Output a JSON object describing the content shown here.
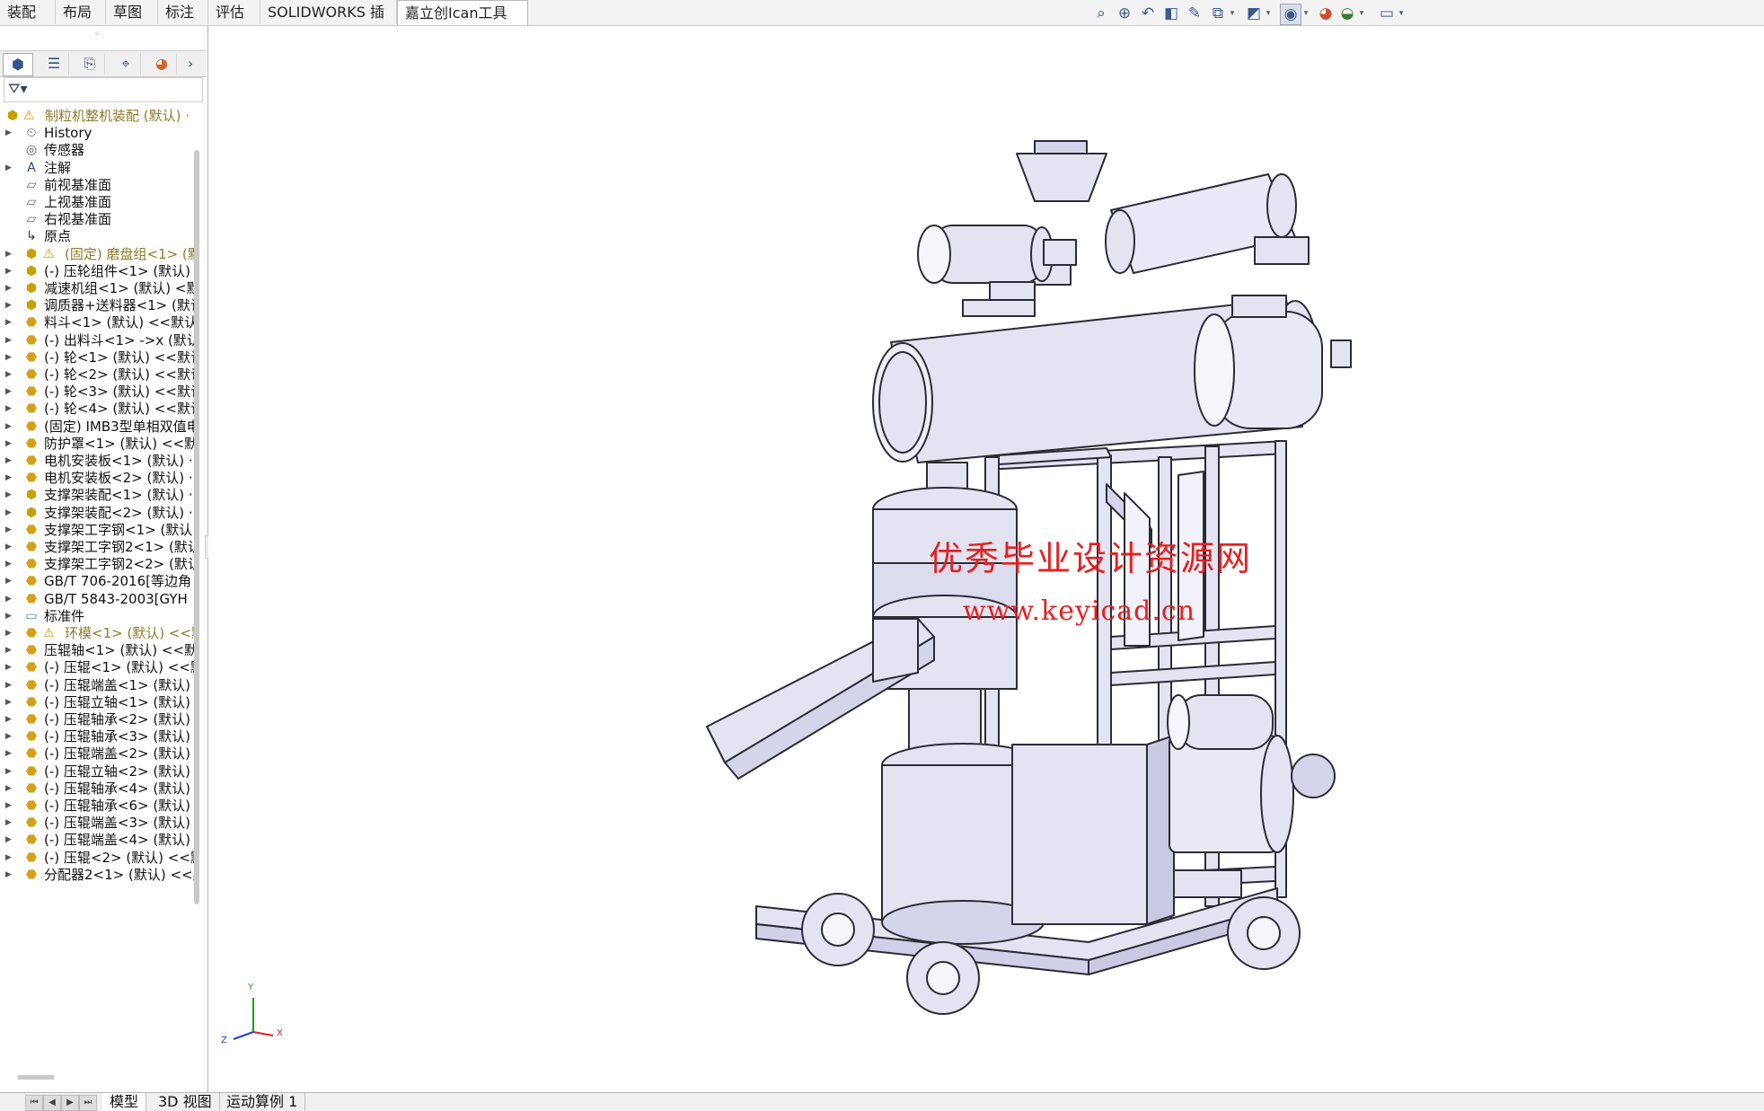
{
  "top_tabs": [
    "装配体",
    "布局",
    "草图",
    "标注",
    "评估",
    "SOLIDWORKS 插件",
    "嘉立创Ican工具箱"
  ],
  "hud_icons": [
    "zoom-to-fit-icon",
    "zoom-area-icon",
    "previous-view-icon",
    "section-view-icon",
    "dynamic-annotation-icon",
    "view-orientation-icon",
    "display-style-icon",
    "hide-show-icon",
    "edit-appearance-icon",
    "apply-scene-icon",
    "view-settings-icon"
  ],
  "panel_tabs": [
    "featuremanager-icon",
    "propertymanager-icon",
    "configurationmanager-icon",
    "dimxpert-icon",
    "appearance-icon"
  ],
  "tree": [
    {
      "label": "制粒机整机装配 (默认) ·",
      "icon": "assembly-icon",
      "warn": true,
      "dim": true,
      "top": true
    },
    {
      "label": "History",
      "icon": "history-icon"
    },
    {
      "label": "传感器",
      "icon": "sensor-icon"
    },
    {
      "label": "注解",
      "icon": "annotation-icon"
    },
    {
      "label": "前视基准面",
      "icon": "plane-icon"
    },
    {
      "label": "上视基准面",
      "icon": "plane-icon"
    },
    {
      "label": "右视基准面",
      "icon": "plane-icon"
    },
    {
      "label": "原点",
      "icon": "origin-icon"
    },
    {
      "label": "(固定) 磨盘组<1> (默",
      "icon": "subassembly-icon",
      "warn": true,
      "dim": true
    },
    {
      "label": "(-) 压轮组件<1> (默认)",
      "icon": "subassembly-icon"
    },
    {
      "label": "减速机组<1> (默认) <默",
      "icon": "subassembly-icon"
    },
    {
      "label": "调质器+送料器<1> (默认",
      "icon": "subassembly-icon"
    },
    {
      "label": "料斗<1> (默认) <<默认",
      "icon": "part-icon"
    },
    {
      "label": "(-) 出料斗<1> ->x (默认",
      "icon": "part-icon"
    },
    {
      "label": "(-) 轮<1> (默认) <<默认",
      "icon": "part-icon"
    },
    {
      "label": "(-) 轮<2> (默认) <<默认",
      "icon": "part-icon"
    },
    {
      "label": "(-) 轮<3> (默认) <<默认",
      "icon": "part-icon"
    },
    {
      "label": "(-) 轮<4> (默认) <<默认",
      "icon": "part-icon"
    },
    {
      "label": "(固定) IMB3型单相双值电",
      "icon": "part-icon"
    },
    {
      "label": "防护罩<1> (默认) <<默",
      "icon": "part-icon"
    },
    {
      "label": "电机安装板<1> (默认) ·",
      "icon": "part-icon"
    },
    {
      "label": "电机安装板<2> (默认) ·",
      "icon": "part-icon"
    },
    {
      "label": "支撑架装配<1> (默认) ·",
      "icon": "subassembly-icon"
    },
    {
      "label": "支撑架装配<2> (默认) ·",
      "icon": "subassembly-icon"
    },
    {
      "label": "支撑架工字钢<1> (默认",
      "icon": "part-icon"
    },
    {
      "label": "支撑架工字钢2<1> (默认",
      "icon": "part-icon"
    },
    {
      "label": "支撑架工字钢2<2> (默认",
      "icon": "part-icon"
    },
    {
      "label": "GB/T 706-2016[等边角",
      "icon": "part-icon"
    },
    {
      "label": "GB/T 5843-2003[GYH",
      "icon": "part-icon"
    },
    {
      "label": "标准件",
      "icon": "folder-icon"
    },
    {
      "label": "环模<1> (默认) <<默",
      "icon": "part-icon",
      "warn": true,
      "dim": true
    },
    {
      "label": "压辊轴<1> (默认) <<默",
      "icon": "part-icon"
    },
    {
      "label": "(-) 压辊<1> (默认) <<默",
      "icon": "part-icon"
    },
    {
      "label": "(-) 压辊端盖<1> (默认)",
      "icon": "part-icon"
    },
    {
      "label": "(-) 压辊立轴<1> (默认)",
      "icon": "part-icon"
    },
    {
      "label": "(-) 压辊轴承<2> (默认)",
      "icon": "part-icon"
    },
    {
      "label": "(-) 压辊轴承<3> (默认)",
      "icon": "part-icon"
    },
    {
      "label": "(-) 压辊端盖<2> (默认)",
      "icon": "part-icon"
    },
    {
      "label": "(-) 压辊立轴<2> (默认)",
      "icon": "part-icon"
    },
    {
      "label": "(-) 压辊轴承<4> (默认)",
      "icon": "part-icon"
    },
    {
      "label": "(-) 压辊轴承<6> (默认)",
      "icon": "part-icon"
    },
    {
      "label": "(-) 压辊端盖<3> (默认)",
      "icon": "part-icon"
    },
    {
      "label": "(-) 压辊端盖<4> (默认)",
      "icon": "part-icon"
    },
    {
      "label": "(-) 压辊<2> (默认) <<默",
      "icon": "part-icon"
    },
    {
      "label": "分配器2<1> (默认) <<默",
      "icon": "part-icon"
    }
  ],
  "watermark": {
    "text": "优秀毕业设计资源网",
    "url": "www.keyicad.cn",
    "color": "#e62020"
  },
  "triad": {
    "x": "X",
    "y": "Y",
    "z": "Z"
  },
  "bottom_tabs": [
    "模型",
    "3D 视图",
    "运动算例 1"
  ],
  "colors": {
    "model_fill": "#e3e3f2",
    "model_shade": "#c9c9e2",
    "model_stroke": "#2b2b35",
    "accent": "#33558a"
  }
}
